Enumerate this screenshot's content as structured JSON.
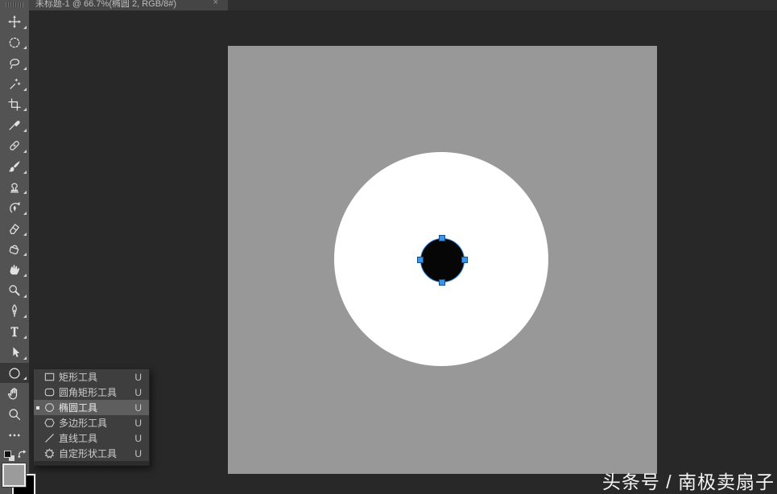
{
  "window": {
    "tab_title": "未标题-1 @ 66.7%(椭圆 2, RGB/8#)",
    "close_glyph": "×"
  },
  "toolbar": {
    "tools": [
      {
        "icon": "move-icon",
        "selected": false
      },
      {
        "icon": "elliptical-marquee-icon",
        "selected": false
      },
      {
        "icon": "lasso-icon",
        "selected": false
      },
      {
        "icon": "magic-wand-icon",
        "selected": false
      },
      {
        "icon": "crop-icon",
        "selected": false
      },
      {
        "icon": "eyedropper-icon",
        "selected": false
      },
      {
        "icon": "healing-brush-icon",
        "selected": false
      },
      {
        "icon": "brush-icon",
        "selected": false
      },
      {
        "icon": "clone-stamp-icon",
        "selected": false
      },
      {
        "icon": "history-brush-icon",
        "selected": false
      },
      {
        "icon": "eraser-icon",
        "selected": false
      },
      {
        "icon": "paint-bucket-icon",
        "selected": false
      },
      {
        "icon": "smudge-icon",
        "selected": false
      },
      {
        "icon": "dodge-icon",
        "selected": false
      },
      {
        "icon": "pen-icon",
        "selected": false
      },
      {
        "icon": "type-icon",
        "selected": false
      },
      {
        "icon": "path-select-icon",
        "selected": false
      },
      {
        "icon": "ellipse-tool-icon",
        "selected": true
      },
      {
        "icon": "hand-icon",
        "selected": false
      },
      {
        "icon": "zoom-icon",
        "selected": false
      },
      {
        "icon": "ellipsis-icon",
        "selected": false
      }
    ],
    "foreground_color": "#9b9b9b",
    "background_color": "#000000"
  },
  "flyout": {
    "items": [
      {
        "icon": "rectangle-icon",
        "label": "矩形工具",
        "shortcut": "U",
        "selected": false
      },
      {
        "icon": "rounded-rectangle-icon",
        "label": "圆角矩形工具",
        "shortcut": "U",
        "selected": false
      },
      {
        "icon": "ellipse-icon",
        "label": "椭圆工具",
        "shortcut": "U",
        "selected": true
      },
      {
        "icon": "polygon-icon",
        "label": "多边形工具",
        "shortcut": "U",
        "selected": false
      },
      {
        "icon": "line-icon",
        "label": "直线工具",
        "shortcut": "U",
        "selected": false
      },
      {
        "icon": "custom-shape-icon",
        "label": "自定形状工具",
        "shortcut": "U",
        "selected": false
      }
    ]
  },
  "canvas": {
    "document_color": "#989898",
    "shapes": [
      {
        "name": "white-circle",
        "fill": "#ffffff"
      },
      {
        "name": "black-circle",
        "fill": "#060606",
        "path_color": "#2a7dd6",
        "handle_color": "#3b93ea"
      }
    ]
  },
  "watermark": {
    "text": "头条号 / 南极卖扇子"
  },
  "colors": {
    "panel": "#535353",
    "pasteboard": "#282828",
    "tab": "#454545",
    "menu": "#3e3e3e",
    "menu_selected": "#5e5e5e",
    "accent_blue": "#2a7dd6"
  }
}
